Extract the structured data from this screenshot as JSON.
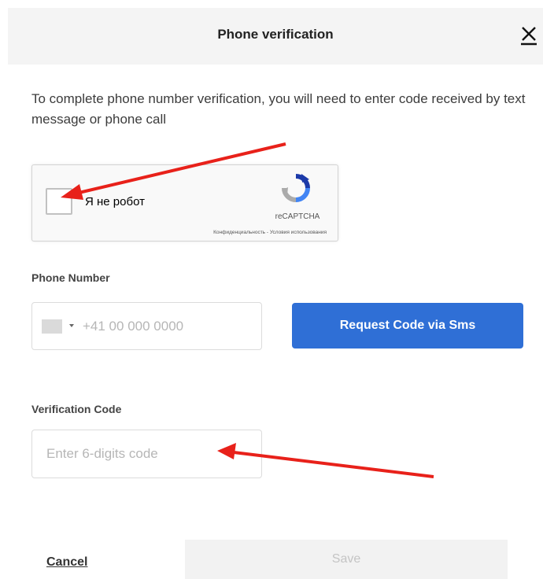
{
  "dialog": {
    "title": "Phone verification",
    "intro": "To complete phone number verification, you will need to enter code received by text message or phone call"
  },
  "recaptcha": {
    "label": "Я не робот",
    "brand": "reCAPTCHA",
    "links": "Конфиденциальность - Условия использования"
  },
  "phone": {
    "label": "Phone Number",
    "placeholder": "+41 00 000 0000",
    "request_button": "Request Code via Sms"
  },
  "verification": {
    "label": "Verification Code",
    "placeholder": "Enter 6-digits code"
  },
  "footer": {
    "cancel_label": "Cancel",
    "save_label": "Save"
  },
  "colors": {
    "primary_button": "#2f6fd6",
    "annotation_arrow": "#e8211a",
    "header_background": "#f4f4f4"
  },
  "icons": {
    "close": "close-icon",
    "recaptcha_logo": "recaptcha-logo-icon",
    "country_flag": "flag-icon",
    "dropdown": "caret-down-icon"
  }
}
